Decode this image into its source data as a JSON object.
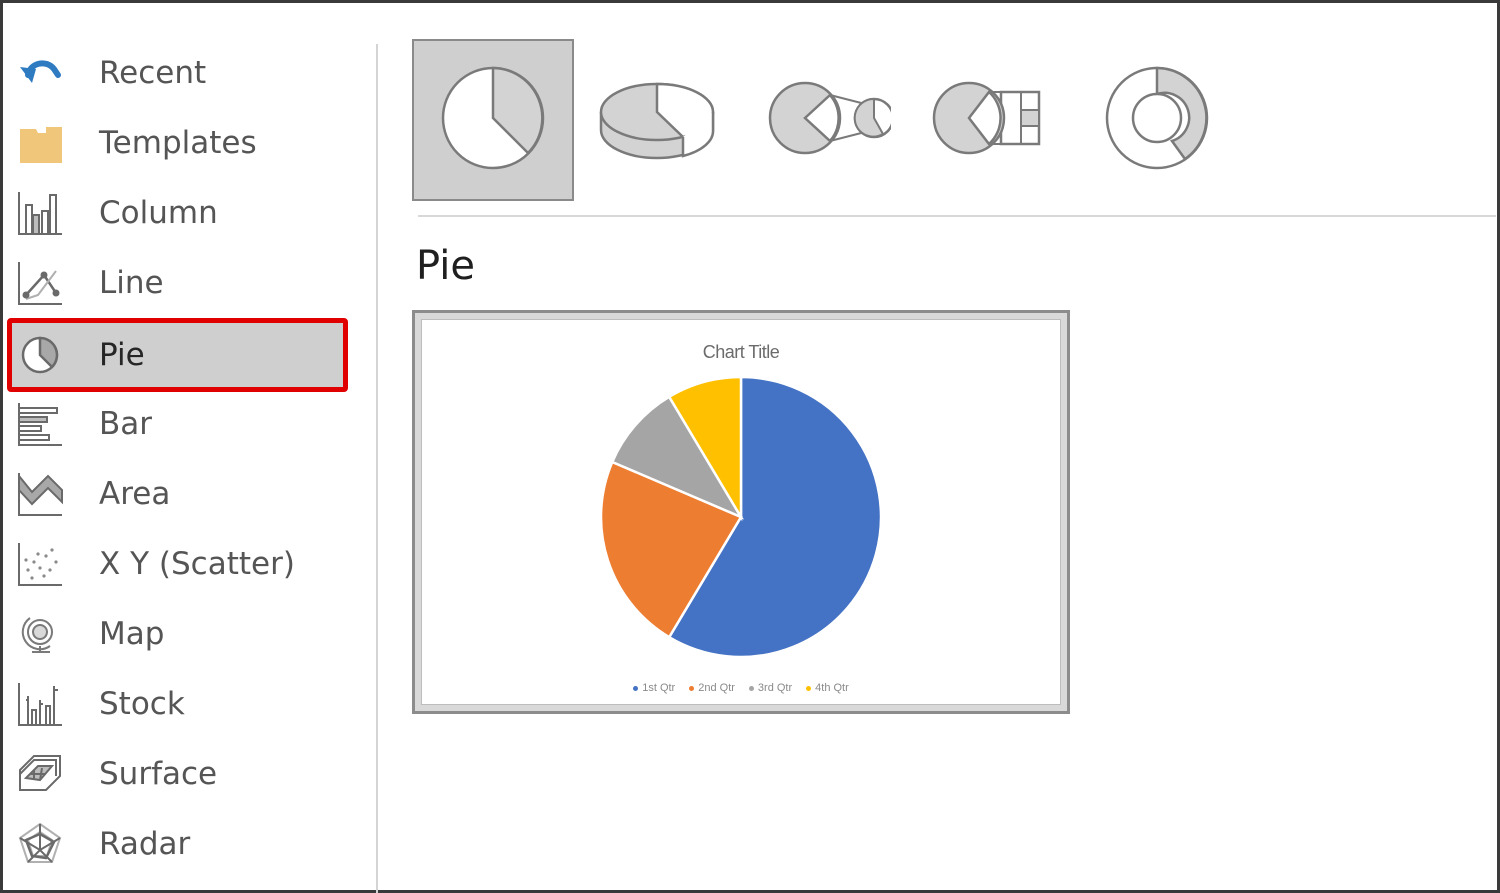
{
  "sidebar": {
    "items": [
      {
        "label": "Recent",
        "icon": "recent-arrow-icon"
      },
      {
        "label": "Templates",
        "icon": "folder-icon"
      },
      {
        "label": "Column",
        "icon": "column-chart-icon"
      },
      {
        "label": "Line",
        "icon": "line-chart-icon"
      },
      {
        "label": "Pie",
        "icon": "pie-chart-icon",
        "selected": true
      },
      {
        "label": "Bar",
        "icon": "bar-chart-icon"
      },
      {
        "label": "Area",
        "icon": "area-chart-icon"
      },
      {
        "label": "X Y (Scatter)",
        "icon": "scatter-chart-icon"
      },
      {
        "label": "Map",
        "icon": "globe-icon"
      },
      {
        "label": "Stock",
        "icon": "stock-chart-icon"
      },
      {
        "label": "Surface",
        "icon": "surface-chart-icon"
      },
      {
        "label": "Radar",
        "icon": "radar-chart-icon"
      }
    ],
    "highlight_color": "#e00000"
  },
  "subtypes": [
    {
      "name": "Pie",
      "icon": "pie-icon",
      "selected": true
    },
    {
      "name": "3-D Pie",
      "icon": "pie-3d-icon"
    },
    {
      "name": "Pie of Pie",
      "icon": "pie-of-pie-icon"
    },
    {
      "name": "Bar of Pie",
      "icon": "bar-of-pie-icon"
    },
    {
      "name": "Doughnut",
      "icon": "doughnut-icon"
    }
  ],
  "section": {
    "title": "Pie"
  },
  "chart_data": {
    "type": "pie",
    "title": "Chart Title",
    "categories": [
      "1st Qtr",
      "2nd Qtr",
      "3rd Qtr",
      "4th Qtr"
    ],
    "values": [
      8.2,
      3.2,
      1.4,
      1.2
    ],
    "colors": [
      "#4472c4",
      "#ed7d31",
      "#a5a5a5",
      "#ffc000"
    ],
    "start_angle_deg": 0,
    "direction": "clockwise",
    "legend_position": "bottom"
  }
}
